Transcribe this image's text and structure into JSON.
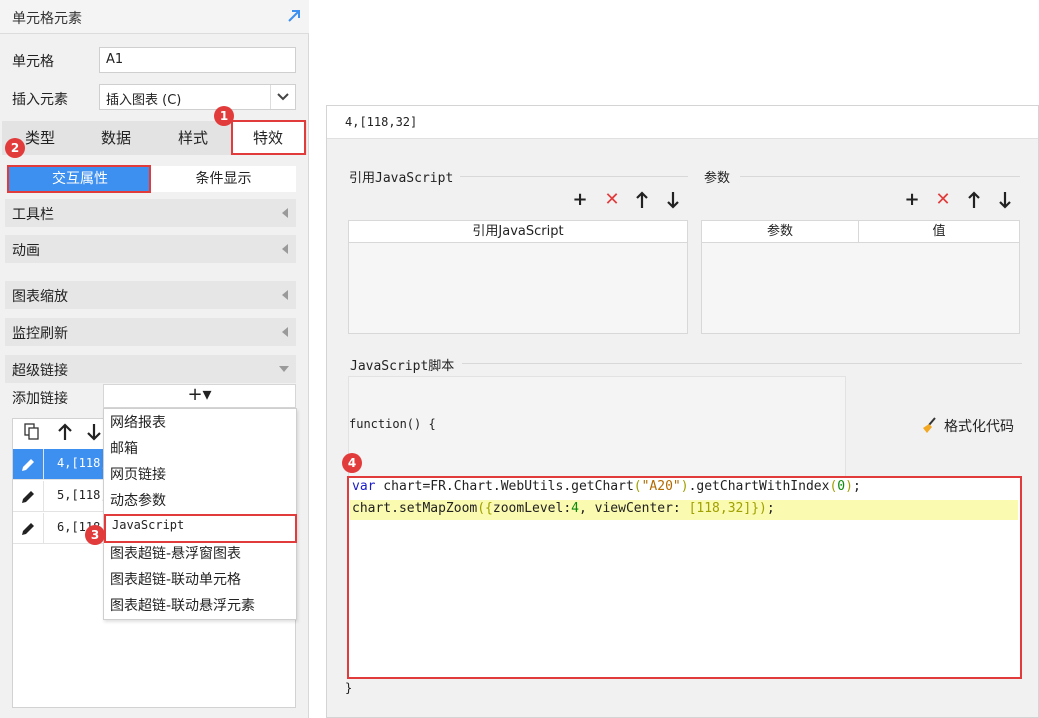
{
  "left_panel": {
    "title": "单元格元素",
    "cell_label": "单元格",
    "cell_value": "A1",
    "insert_label": "插入元素",
    "insert_value": "插入图表 (C)",
    "tabs": [
      "类型",
      "数据",
      "样式",
      "特效"
    ],
    "subtabs": [
      "交互属性",
      "条件显示"
    ],
    "sections": [
      "工具栏",
      "动画",
      "图表缩放",
      "监控刷新",
      "超级链接"
    ],
    "add_link_label": "添加链接",
    "add_button": "+▾",
    "link_rows": [
      "4,[118,32]",
      "5,[118,32]",
      "6,[118,32]"
    ],
    "menu_items": [
      "网络报表",
      "邮箱",
      "网页链接",
      "动态参数",
      "JavaScript",
      "图表超链-悬浮窗图表",
      "图表超链-联动单元格",
      "图表超链-联动悬浮元素"
    ]
  },
  "badges": [
    "1",
    "2",
    "3",
    "4"
  ],
  "dialog": {
    "title": "4,[118,32]",
    "ref_js_group": "引用JavaScript",
    "params_group": "参数",
    "ref_js_column": "引用JavaScript",
    "param_column": "参数",
    "value_column": "值",
    "script_group": "JavaScript脚本",
    "function_open": "function() {",
    "function_close": "}",
    "format_code": "格式化代码",
    "code": {
      "l1_var": "var",
      "l1_a": " chart=FR.Chart.WebUtils.getChart",
      "l1_p1": "(",
      "l1_str": "\"A20\"",
      "l1_p2": ")",
      "l1_b": ".getChartWithIndex",
      "l1_p3": "(",
      "l1_num": "0",
      "l1_p4": ")",
      "l1_end": ";",
      "l2_a": "chart.setMapZoom",
      "l2_p1": "({",
      "l2_b": "zoomLevel:",
      "l2_num1": "4",
      "l2_c": ", viewCenter: ",
      "l2_arr": "[118,32]",
      "l2_p2": "})",
      "l2_end": ";"
    }
  },
  "colors": {
    "accent": "#3d8ff0",
    "highlight_red": "#e23b3b",
    "code_highlight": "#fafab0"
  }
}
